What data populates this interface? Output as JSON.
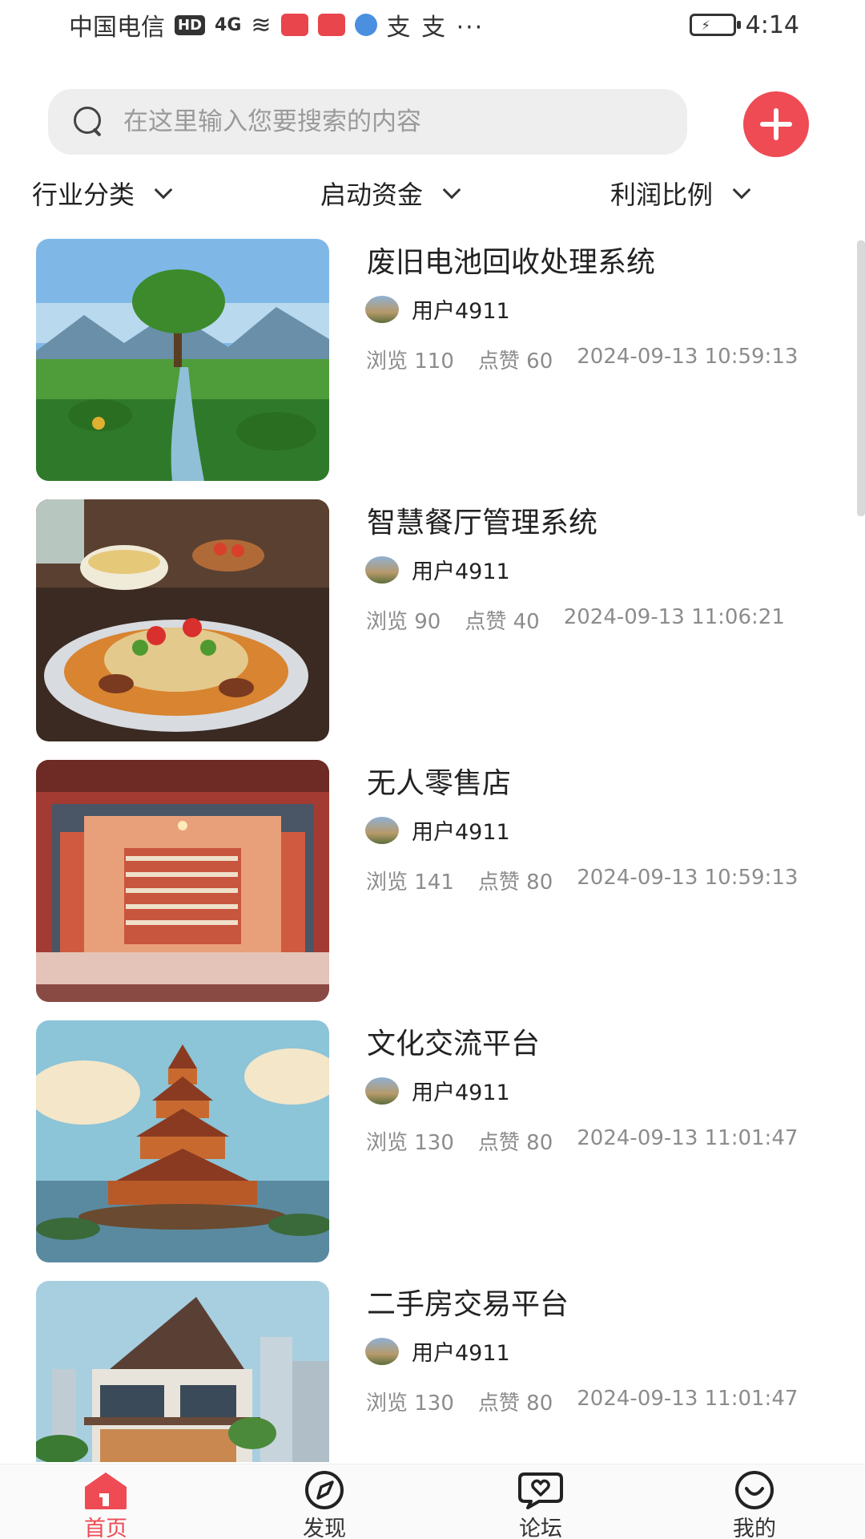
{
  "status_bar": {
    "carrier": "中国电信",
    "hd": "HD",
    "signal": "4G",
    "apps_text": "支 支 ···",
    "time": "4:14"
  },
  "search": {
    "placeholder": "在这里输入您要搜索的内容",
    "value": ""
  },
  "filters": [
    {
      "label": "行业分类"
    },
    {
      "label": "启动资金"
    },
    {
      "label": "利润比例"
    }
  ],
  "items": [
    {
      "title": "废旧电池回收处理系统",
      "author": "用户4911",
      "views": "浏览 110",
      "likes": "点赞 60",
      "date": "2024-09-13 10:59:13",
      "image": "green-field-tree"
    },
    {
      "title": "智慧餐厅管理系统",
      "author": "用户4911",
      "views": "浏览 90",
      "likes": "点赞 40",
      "date": "2024-09-13 11:06:21",
      "image": "noodle-dish"
    },
    {
      "title": "无人零售店",
      "author": "用户4911",
      "views": "浏览 141",
      "likes": "点赞 80",
      "date": "2024-09-13 10:59:13",
      "image": "store-front"
    },
    {
      "title": "文化交流平台",
      "author": "用户4911",
      "views": "浏览 130",
      "likes": "点赞 80",
      "date": "2024-09-13 11:01:47",
      "image": "pagoda"
    },
    {
      "title": "二手房交易平台",
      "author": "用户4911",
      "views": "浏览 130",
      "likes": "点赞 80",
      "date": "2024-09-13 11:01:47",
      "image": "house"
    }
  ],
  "bottom_nav": [
    {
      "label": "首页",
      "icon": "home-icon",
      "active": true
    },
    {
      "label": "发现",
      "icon": "compass-icon",
      "active": false
    },
    {
      "label": "论坛",
      "icon": "chat-heart-icon",
      "active": false
    },
    {
      "label": "我的",
      "icon": "smile-icon",
      "active": false
    }
  ],
  "colors": {
    "accent": "#ee4b54",
    "muted_text": "#8c8c8c",
    "search_bg": "#eeeeee"
  }
}
